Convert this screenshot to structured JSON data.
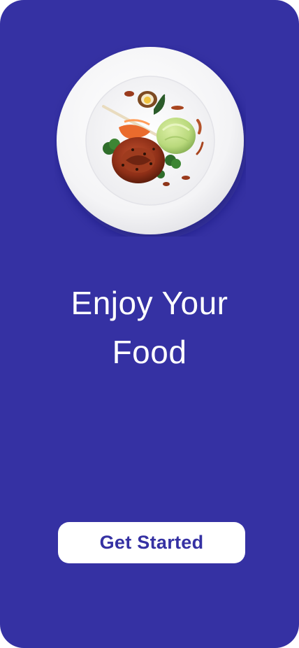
{
  "screen": {
    "background_color": "#3531a3"
  },
  "hero": {
    "image_icon": "plated-dish-illustration"
  },
  "headline": {
    "line1": "Enjoy Your",
    "line2": "Food"
  },
  "cta": {
    "label": "Get Started",
    "text_color": "#3531a3",
    "background_color": "#ffffff"
  }
}
